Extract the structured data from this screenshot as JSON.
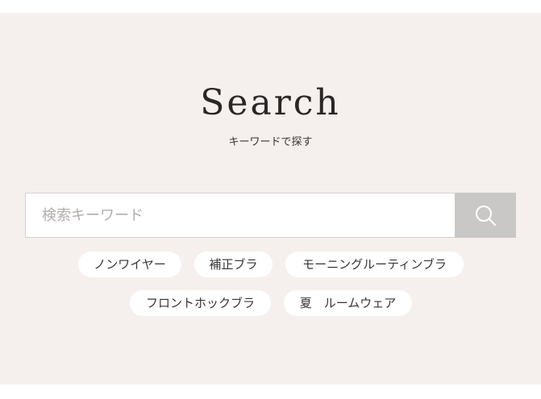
{
  "header": {
    "title": "Search",
    "subtitle": "キーワードで探す"
  },
  "search": {
    "placeholder": "検索キーワード",
    "button_icon": "search-icon"
  },
  "tags": [
    "ノンワイヤー",
    "補正ブラ",
    "モーニングルーティンブラ",
    "フロントホックブラ",
    "夏　ルームウェア"
  ],
  "colors": {
    "panel_background": "#f5f0ee",
    "search_button": "#cac8c7",
    "text": "#2a2626"
  }
}
